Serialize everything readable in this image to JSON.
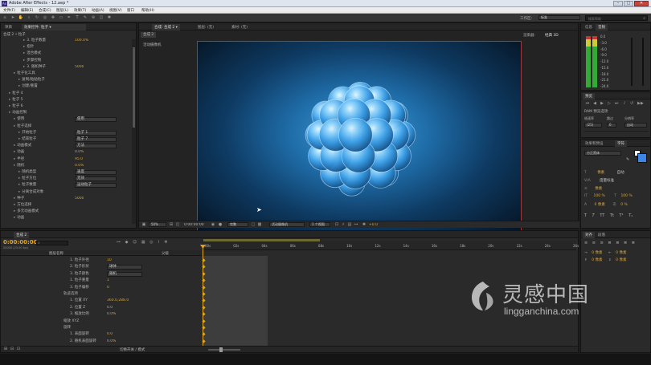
{
  "app": {
    "title": "Adobe After Effects - 12.aep *"
  },
  "menu": [
    "文件(F)",
    "编辑(E)",
    "合成(C)",
    "图层(L)",
    "效果(T)",
    "动画(A)",
    "视图(V)",
    "窗口",
    "帮助(H)"
  ],
  "toolbar": {
    "workspace_label": "工作区:",
    "workspace_value": "标准",
    "search_placeholder": "搜索帮助"
  },
  "effect_controls": {
    "tabs": [
      "项目",
      "效果控件: 粒子 ▾"
    ],
    "header": "合成 2 • 粒子",
    "rows": [
      {
        "label": "3. 粒子数量",
        "value": "100.0%"
      },
      {
        "label": "指针",
        "value": ""
      },
      {
        "label": "混合模式",
        "value": ""
      },
      {
        "label": "步骤控制",
        "value": ""
      },
      {
        "label": "3. 随机种子",
        "value": "5000"
      },
      {
        "label": "粒子化工具",
        "value": ""
      },
      {
        "label": "复制/粘贴粒子",
        "value": ""
      },
      {
        "label": "创建/重置",
        "value": ""
      },
      {
        "label": "粒子 4",
        "value": ""
      },
      {
        "label": "粒子 5",
        "value": ""
      },
      {
        "label": "粒子 6",
        "value": ""
      },
      {
        "label": "动画控制",
        "value": ""
      },
      {
        "label": "使用",
        "value": "使用"
      },
      {
        "label": "粒子选择",
        "value": ""
      },
      {
        "label": "开始粒子",
        "value": "粒子 1"
      },
      {
        "label": "结束粒子",
        "value": "粒子 7"
      },
      {
        "label": "动画模式",
        "value": "方法"
      },
      {
        "label": "动画",
        "value": "0.0%"
      },
      {
        "label": "半径",
        "value": "95.0"
      },
      {
        "label": "随机",
        "value": "0.0%"
      },
      {
        "label": "随机类型",
        "value": "速度"
      },
      {
        "label": "粒子方位",
        "value": "无效"
      },
      {
        "label": "粒子数量",
        "value": "运动粒子"
      },
      {
        "label": "分离合成对象",
        "value": ""
      },
      {
        "label": "种子",
        "value": "5000"
      },
      {
        "label": "方位选择",
        "value": ""
      },
      {
        "label": "多元动画模式",
        "value": ""
      },
      {
        "label": "动画",
        "value": ""
      }
    ]
  },
  "composition": {
    "tabs": [
      "合成: 合成 2 ▾",
      "图层: (无)",
      "素材: (无)"
    ],
    "sub_tab": "合成 2",
    "label": "活动摄像机",
    "renderer_label": "渲染器:",
    "renderer_value": "经典 3D",
    "footer": {
      "zoom": "50%",
      "timecode": "0:00:00:00",
      "resolution": "完整",
      "camera": "活动摄像机",
      "views": "1 个视图",
      "exposure": "+0.0"
    }
  },
  "right_panels": {
    "info_tab": "信息",
    "audio_tab": "音频",
    "audio_scale": [
      "0.0",
      "-3.0",
      "-6.0",
      "-9.0",
      "-12.0",
      "-15.0",
      "-18.0",
      "-21.0",
      "-24.0"
    ],
    "preview_tab": "预览",
    "ram_preview": "RAM 预览选项",
    "frame_rate_label": "帧速率",
    "skip_label": "跳过",
    "resolution_label": "分辨率",
    "frame_rate": "(25)",
    "skip": "0",
    "resolution": "自动",
    "effects_tab": "效果和预设",
    "char_tab": "字符",
    "font_name": "方正黑体",
    "px_label": "像素",
    "auto_label": "自动",
    "tracking_label": "度量标准",
    "percent1": "100 %",
    "percent2": "100 %",
    "px2": "0 像素",
    "pct3": "0 %",
    "align_tab": "对齐",
    "para_tab": "段落",
    "align_px": "0 像素"
  },
  "timeline": {
    "tab": "合成 2",
    "timecode": "0:00:00:00",
    "fps": "00000 (25.00 fps)",
    "columns": [
      "图层名称",
      "父级"
    ],
    "ruler": [
      "00s",
      "02s",
      "04s",
      "06s",
      "08s",
      "10s",
      "12s",
      "14s",
      "16s",
      "18s",
      "20s",
      "22s",
      "24s",
      "26s"
    ],
    "rows": [
      {
        "label": "1. 粒子外径",
        "value": "10"
      },
      {
        "label": "2. 粒子形状",
        "value": "球体"
      },
      {
        "label": "3. 粒子颜色",
        "value": "随机"
      },
      {
        "label": "1. 粒子重量",
        "value": "1"
      },
      {
        "label": "3. 粒子偏移",
        "value": "0"
      },
      {
        "label": "轨迹选项",
        "value": ""
      },
      {
        "label": "1. 位置 XY",
        "value": "360.0,288.0"
      },
      {
        "label": "2. 位置 Z",
        "value": "0.0"
      },
      {
        "label": "3. 缩放比例",
        "value": "0.0%"
      },
      {
        "label": "缩放 XYZ",
        "value": ""
      },
      {
        "label": "旋转",
        "value": ""
      },
      {
        "label": "1. 表面旋转",
        "value": "0.0"
      },
      {
        "label": "2. 随机表面旋转",
        "value": "0.0%"
      }
    ],
    "footer": "切换开关 / 模式"
  },
  "watermark": {
    "cn": "灵感中国",
    "en": "lingganchina.com"
  }
}
